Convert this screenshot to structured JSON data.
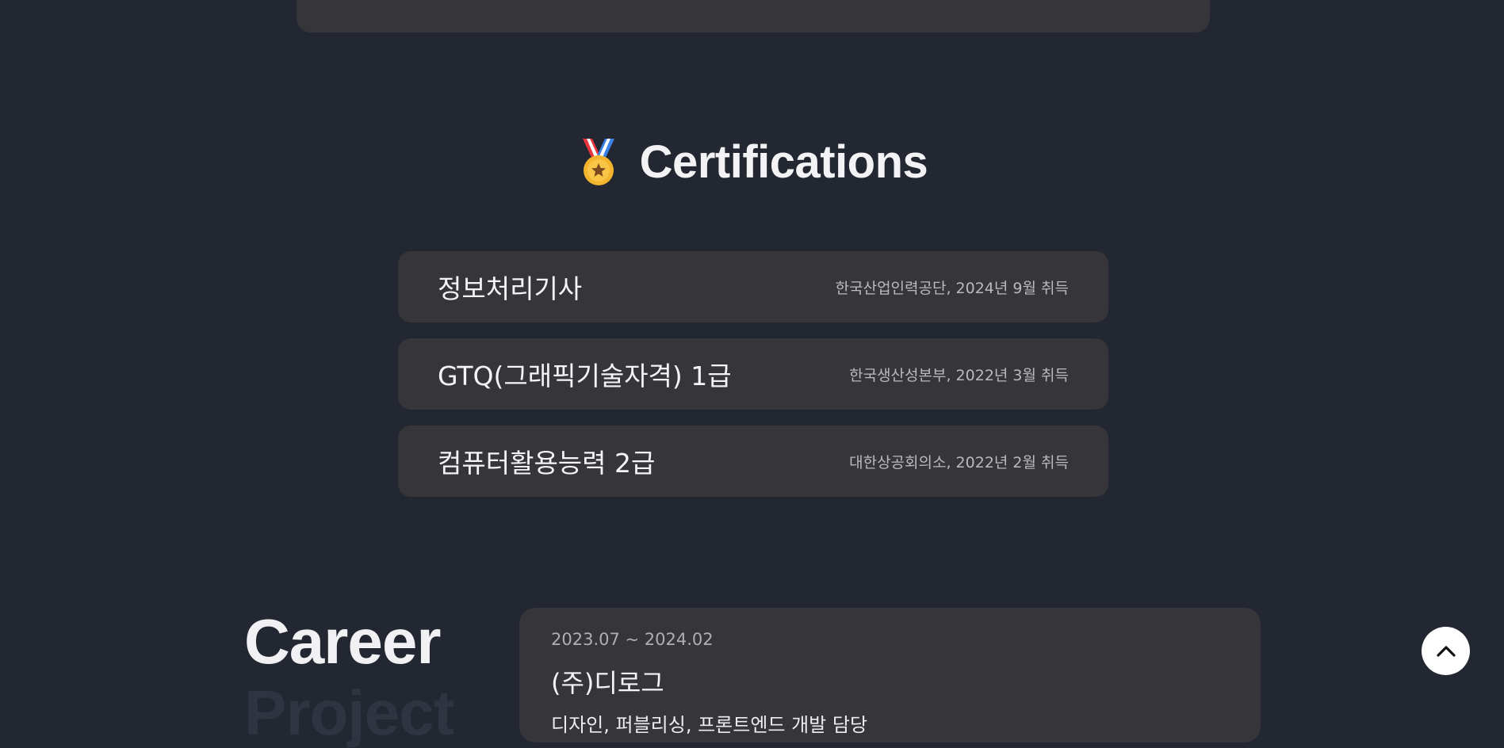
{
  "certifications": {
    "title": "Certifications",
    "icon": "medal-icon",
    "items": [
      {
        "name": "정보처리기사",
        "meta": "한국산업인력공단, 2024년 9월 취득"
      },
      {
        "name": "GTQ(그래픽기술자격) 1급",
        "meta": "한국생산성본부, 2022년 3월 취득"
      },
      {
        "name": "컴퓨터활용능력 2급",
        "meta": "대한상공회의소, 2022년 2월 취득"
      }
    ]
  },
  "career": {
    "label": "Career",
    "next_label": "Project",
    "entries": [
      {
        "period": "2023.07 ~ 2024.02",
        "company": "(주)디로그",
        "role": "디자인, 퍼블리싱, 프론트엔드 개발 담당"
      }
    ]
  },
  "scroll_top": {
    "icon": "chevron-up-icon"
  },
  "colors": {
    "background": "#222731",
    "card": "#363539",
    "text": "#f1f1f3",
    "muted_text": "#b9b9bf"
  }
}
